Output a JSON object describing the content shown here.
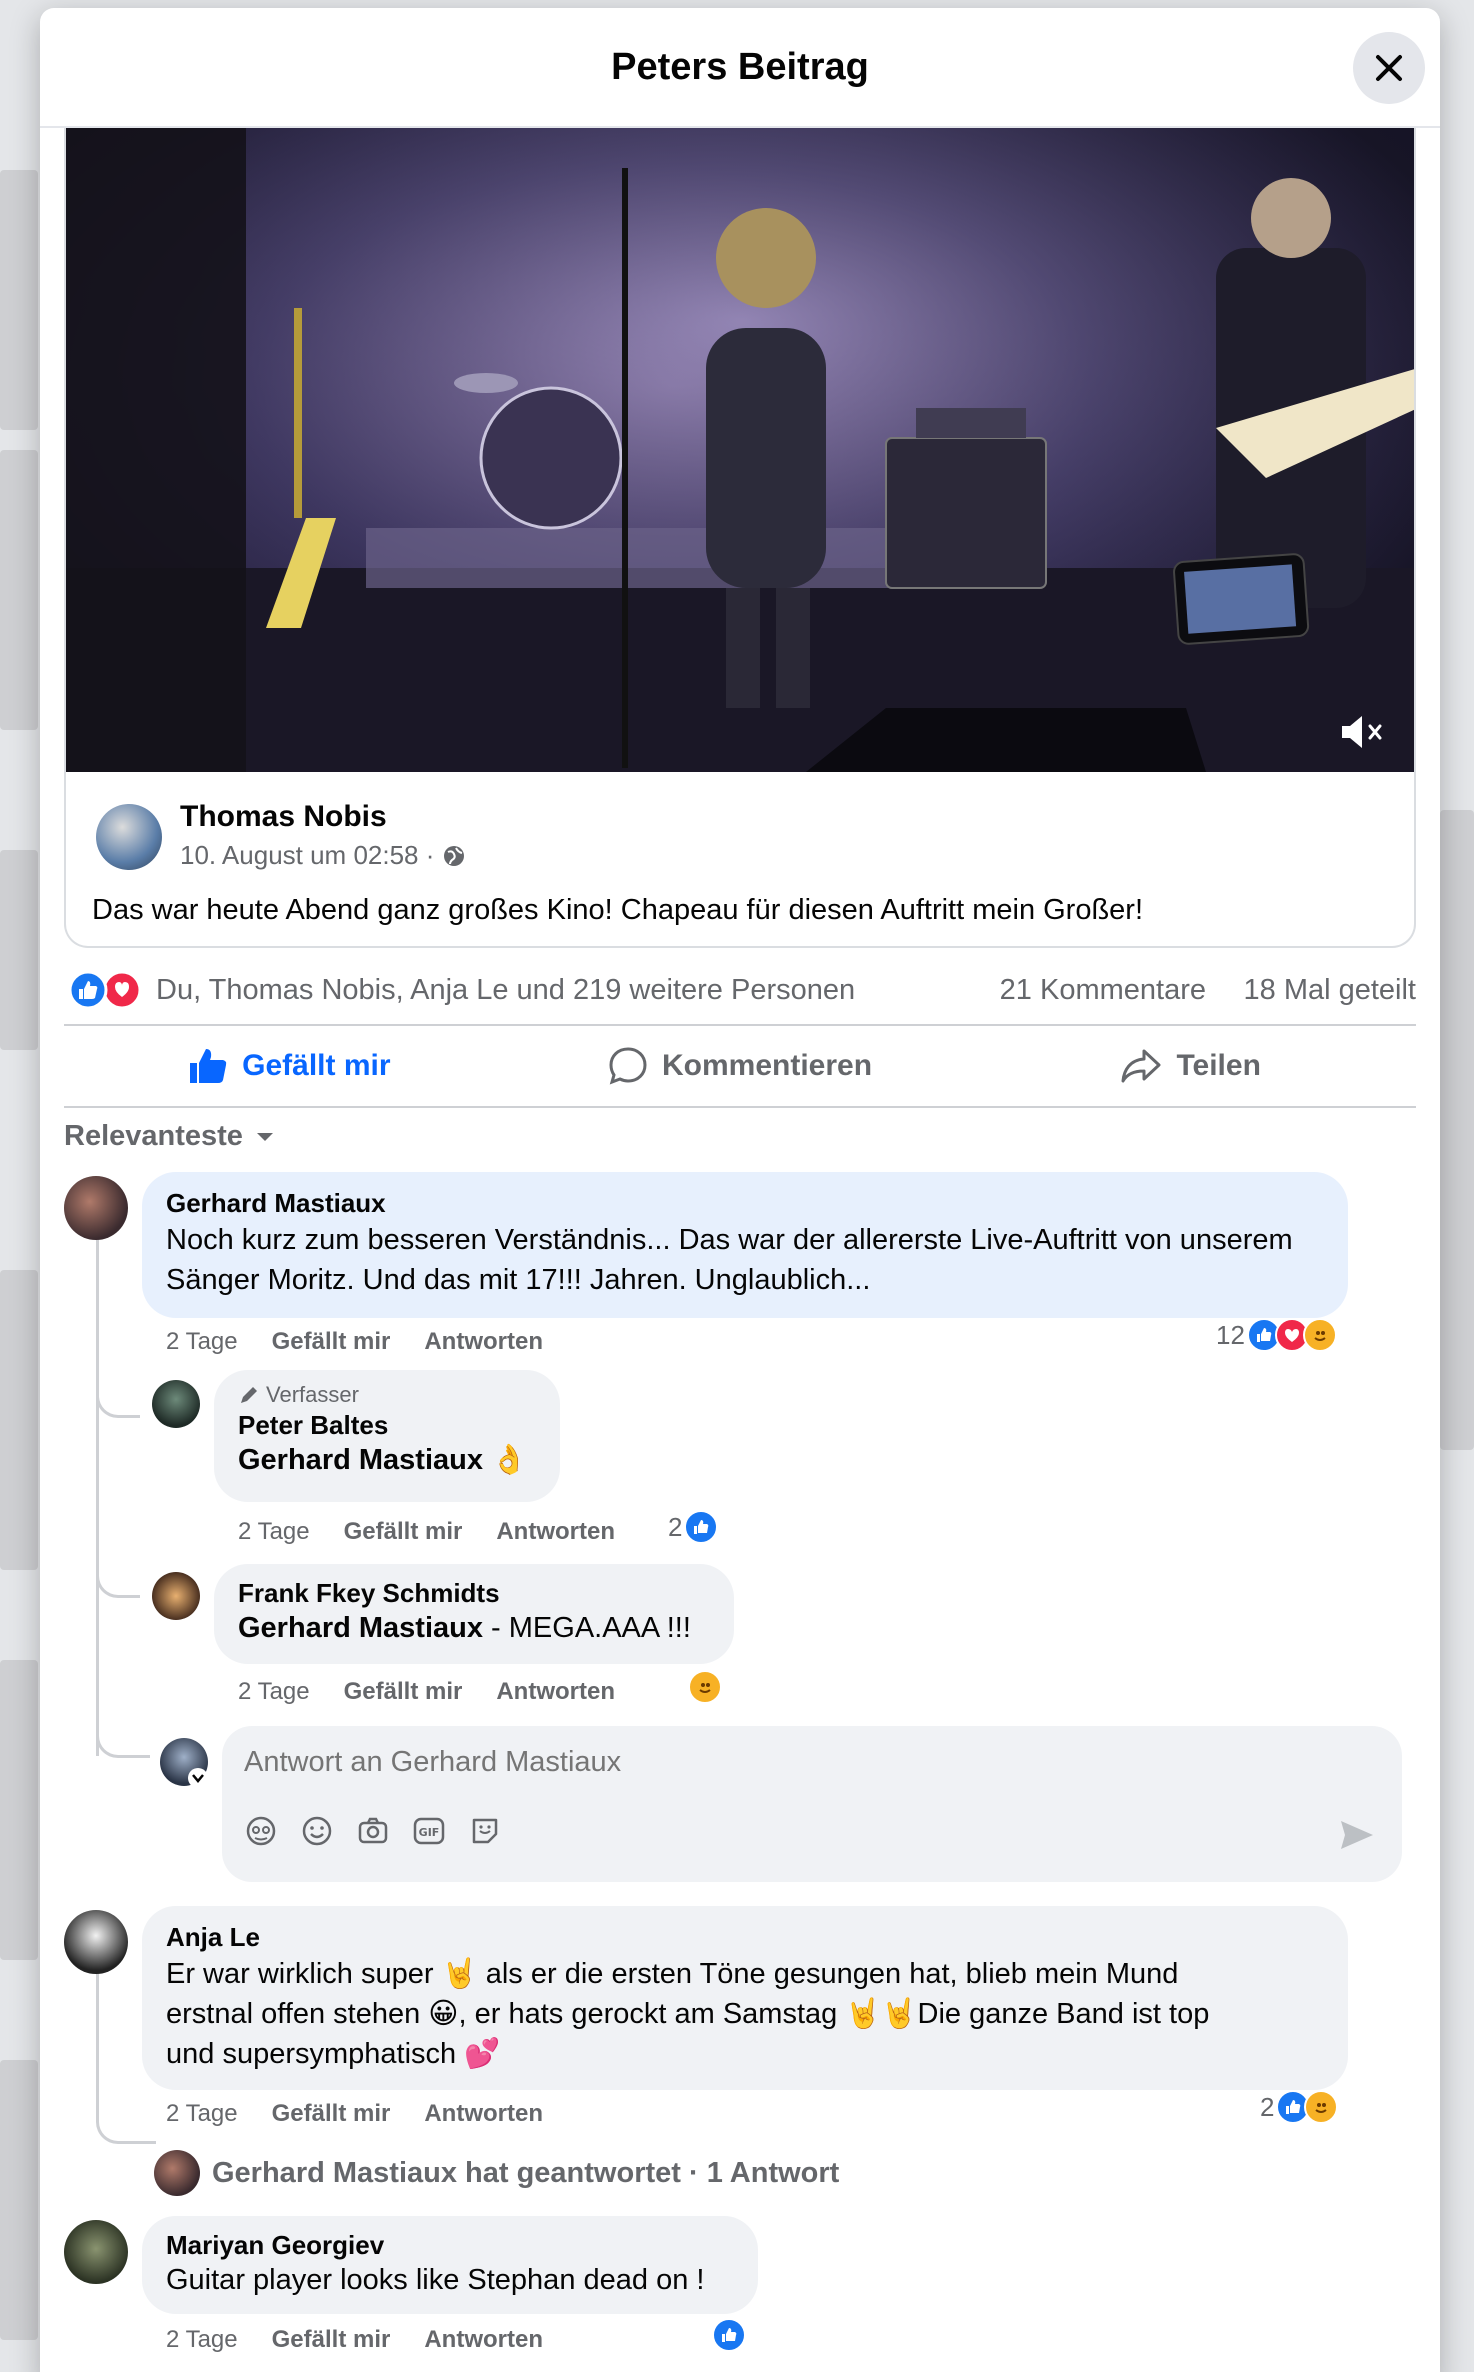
{
  "modal": {
    "title": "Peters Beitrag"
  },
  "post": {
    "author": "Thomas Nobis",
    "date": "10. August um 02:58 ·",
    "text": "Das war heute Abend ganz großes Kino! Chapeau für diesen Auftritt mein Großer!",
    "reactions_text": "Du, Thomas Nobis, Anja Le und 219 weitere Personen",
    "comment_count": "21 Kommentare",
    "share_count": "18 Mal geteilt"
  },
  "actions": {
    "like": "Gefällt mir",
    "comment": "Kommentieren",
    "share": "Teilen"
  },
  "sort_label": "Relevanteste",
  "comments": [
    {
      "name": "Gerhard Mastiaux",
      "text": "Noch kurz zum besseren Verständnis... Das war der allererste Live-Auftritt von unserem Sänger Moritz. Und das mit 17!!! Jahren. Unglaublich...",
      "time": "2 Tage",
      "like": "Gefällt mir",
      "reply": "Antworten",
      "reaction_count": "12"
    },
    {
      "badge": "Verfasser",
      "name": "Peter Baltes",
      "mention": "Gerhard Mastiaux",
      "emoji": "👌",
      "time": "2 Tage",
      "like": "Gefällt mir",
      "reply": "Antworten",
      "reaction_count": "2"
    },
    {
      "name": "Frank Fkey Schmidts",
      "mention": "Gerhard Mastiaux",
      "text": " - MEGA.AAA !!!",
      "time": "2 Tage",
      "like": "Gefällt mir",
      "reply": "Antworten"
    },
    {
      "name": "Anja Le",
      "line1": "Er war wirklich super 🤘 als er die ersten Töne gesungen hat, blieb mein Mund",
      "line2": "erstnal offen stehen 😀, er hats gerockt am Samstag 🤘🤘Die ganze Band ist top",
      "line3": "und supersymphatisch 💕",
      "time": "2 Tage",
      "like": "Gefällt mir",
      "reply": "Antworten",
      "reaction_count": "2"
    },
    {
      "name": "Mariyan Georgiev",
      "text": "Guitar player looks like Stephan dead on !",
      "time": "2 Tage",
      "like": "Gefällt mir",
      "reply": "Antworten"
    }
  ],
  "reply_box": {
    "placeholder": "Antwort an Gerhard Mastiaux"
  },
  "replied_text": "Gerhard Mastiaux hat geantwortet · 1 Antwort",
  "colors": {
    "accent": "#0866ff",
    "secondary_text": "#65676b",
    "bubble": "#f0f2f5",
    "highlight_bubble": "#e7f0fd"
  }
}
